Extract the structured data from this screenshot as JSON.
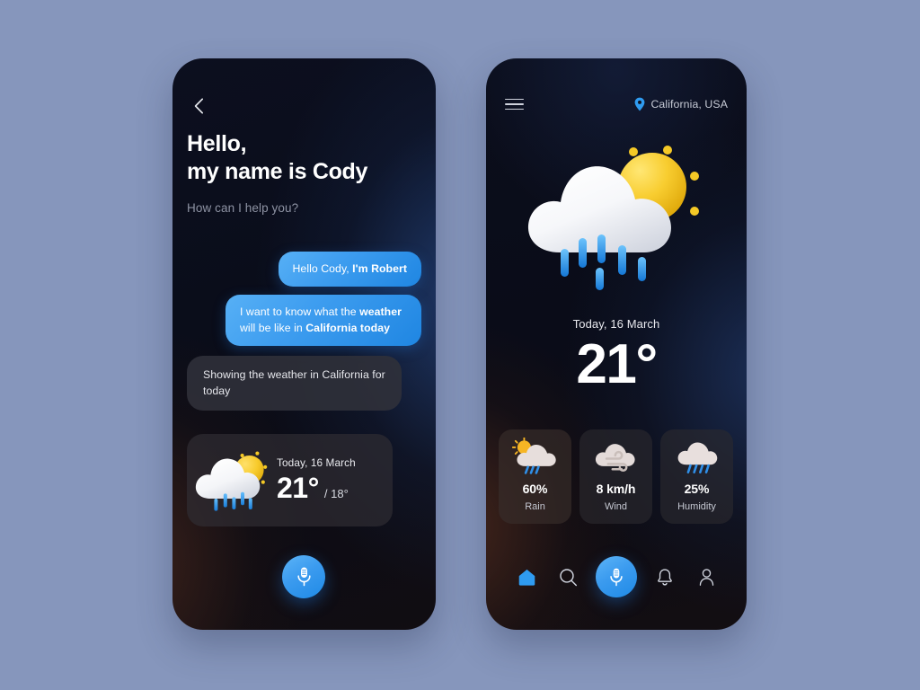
{
  "canvas": {
    "background_color": "#8696bc"
  },
  "accent": {
    "blue": "#3b9bef",
    "blue_light": "#5cb4f7",
    "sun_yellow": "#f5c926",
    "rain_blue": "#2f9bf0"
  },
  "assistant_screen": {
    "back_icon": "chevron-left-icon",
    "greeting_line1": "Hello,",
    "greeting_line2": "my name is Cody",
    "greeting_sub": "How can I help you?",
    "messages": [
      {
        "from": "user",
        "plain1": "Hello Cody, ",
        "bold1": "I'm Robert",
        "plain2": "",
        "bold2": "",
        "plain3": ""
      },
      {
        "from": "user",
        "plain1": "I want to know what the ",
        "bold1": "weather",
        "plain2": " will be like in ",
        "bold2": "California today",
        "plain3": ""
      },
      {
        "from": "bot",
        "text": "Showing the weather in California for today"
      }
    ],
    "weather_card": {
      "icon": "sun-behind-rain-cloud-icon",
      "date": "Today, 16 March",
      "temp_high": "21°",
      "temp_low": "/ 18°"
    },
    "mic_button": {
      "icon": "microphone-icon",
      "label": ""
    }
  },
  "weather_screen": {
    "menu_icon": "hamburger-menu-icon",
    "location_icon": "location-pin-icon",
    "location": "California, USA",
    "hero_icon": "sun-behind-rain-cloud-icon",
    "date": "Today, 16 March",
    "temperature": "21°",
    "metrics": [
      {
        "icon": "sun-behind-rain-cloud-icon",
        "value": "60%",
        "label": "Rain"
      },
      {
        "icon": "wind-cloud-icon",
        "value": "8 km/h",
        "label": "Wind"
      },
      {
        "icon": "rain-cloud-icon",
        "value": "25%",
        "label": "Humidity"
      }
    ],
    "nav": [
      {
        "icon": "home-icon",
        "label": "Home",
        "active": true
      },
      {
        "icon": "search-icon",
        "label": "Search",
        "active": false
      },
      {
        "icon": "microphone-icon",
        "label": "Voice",
        "active": true
      },
      {
        "icon": "bell-icon",
        "label": "Notifications",
        "active": false
      },
      {
        "icon": "person-icon",
        "label": "Profile",
        "active": false
      }
    ]
  }
}
